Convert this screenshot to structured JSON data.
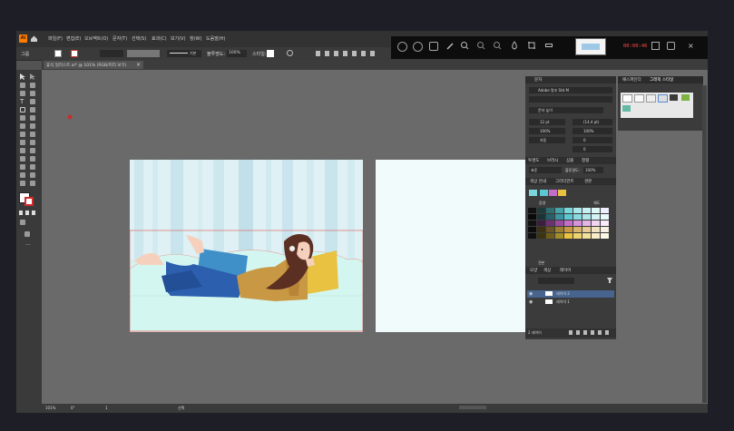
{
  "app": {
    "logo": "Ai",
    "menus": [
      "파일(F)",
      "편집(E)",
      "오브젝트(O)",
      "문자(T)",
      "선택(S)",
      "효과(C)",
      "보기(V)",
      "창(W)",
      "도움말(H)"
    ]
  },
  "control_bar": {
    "group_label": "그룹",
    "opacity_label": "불투명도:",
    "opacity_value": "100%",
    "style_label": "스타일:",
    "stroke_style": "기본"
  },
  "recording_bar": {
    "timer": "00:00:46",
    "icons": [
      "record-icon",
      "pause-icon",
      "screenshot-icon",
      "pen-icon",
      "zoom-in-icon",
      "search-icon",
      "zoom-out-icon",
      "fill-icon",
      "crop-icon"
    ]
  },
  "document_tab": {
    "title": "휴식 일러스트.ai* @ 101% (RGB/미리 보기)",
    "close": "×"
  },
  "artwork": {
    "description_colors": {
      "sky": "#d8eff4",
      "sofa": "#d6f5f0",
      "pants": "#2c5fae",
      "shirt": "#c99844",
      "pillow_blue": "#3f8fc9",
      "pillow_yellow": "#e8c240",
      "hair": "#5b2f22",
      "skin": "#f5d1bd"
    }
  },
  "char_panel": {
    "tab": "문자",
    "font_name": "Adobe 명조 Std M",
    "size": "12 pt",
    "leading": "(14.4 pt)",
    "scale_h": "100%",
    "scale_v": "100%",
    "tracking": "자동",
    "kerning": "0",
    "rotation": "0",
    "style_name": "문자 높이"
  },
  "graphic_styles_panel": {
    "tabs": [
      "패스파인더",
      "그래픽 스타일"
    ]
  },
  "transparency_panel": {
    "tabs": [
      "투명도",
      "브러시",
      "심볼",
      "정렬"
    ],
    "mode": "표준",
    "opacity_label": "불투명도:",
    "opacity_value": "100%"
  },
  "swatches_panel": {
    "tabs": [
      "색상 안내",
      "그라디언트",
      "견본"
    ],
    "col_a": "음영",
    "col_b": "채도",
    "footer": "견본"
  },
  "layers_panel": {
    "tabs": [
      "모양",
      "색상",
      "레이어"
    ],
    "layers": [
      {
        "name": "레이어 2"
      },
      {
        "name": "레이어 1"
      }
    ],
    "footer": "2 레이어"
  },
  "status": {
    "zoom": "101%",
    "angle": "0°",
    "page": "1",
    "tool": "선택"
  }
}
